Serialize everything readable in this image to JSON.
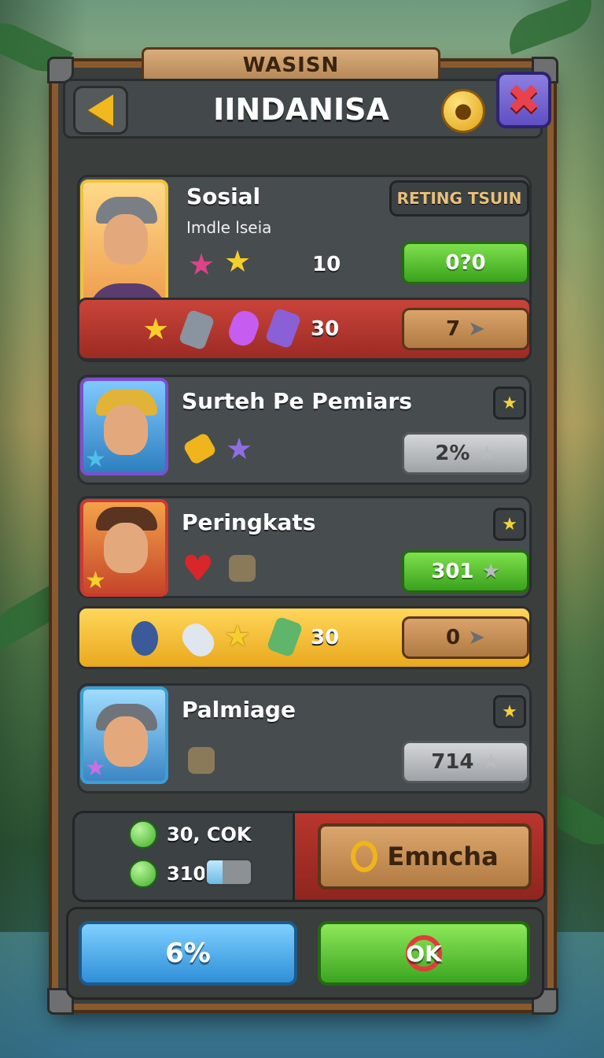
{
  "header": {
    "plank_label": "WASISN",
    "title": "IINDANISA"
  },
  "cards": [
    {
      "name": "Sosial",
      "subtitle": "Imdle lseia",
      "tag": "RETING TSUIN",
      "count": "10",
      "green_value": "0?0",
      "bar_count": "30",
      "bar_value": "7"
    },
    {
      "name": "Surteh Pe Pemiars",
      "gray_value": "2%"
    },
    {
      "name": "Peringkats",
      "green_value": "301",
      "bar_count": "30",
      "bar_value": "0"
    },
    {
      "name": "Palmiage",
      "gray_value": "714"
    }
  ],
  "footer": {
    "resource_1": "30, COK",
    "resource_2": "310",
    "progress_fraction": 0.35,
    "wood_button": "Emncha",
    "blue_button": "6%",
    "green_button": "OK"
  },
  "colors": {
    "panel": "#3a3e3d",
    "frame_wood": "#8a5a2f",
    "green": "#3aa21d",
    "gold": "#f2b91e",
    "red_bar": "#c9443a",
    "blue": "#2f8fd8"
  },
  "icons": [
    "back-arrow-icon",
    "help-icon",
    "close-icon",
    "star-icon",
    "gem-icon",
    "heart-icon",
    "rocket-icon",
    "potion-icon",
    "chevron-right-icon"
  ]
}
